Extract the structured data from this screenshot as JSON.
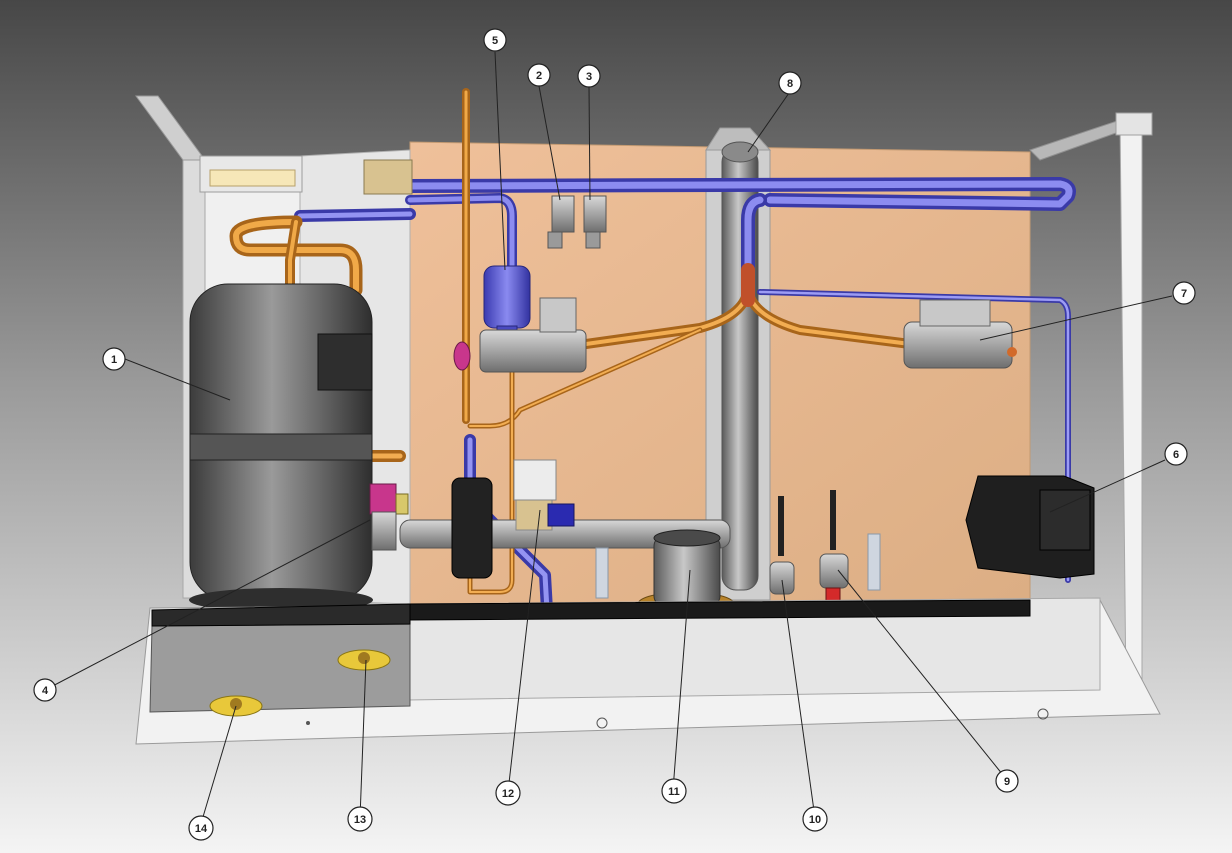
{
  "colors": {
    "background_top": "#4a4a4a",
    "background_bottom": "#f2f2f2",
    "back_panel": "#e8b890",
    "suction_pipe": "#6e6ee8",
    "discharge_pipe": "#d9882a",
    "compressor": "#6a6a6a",
    "frame": "#f4f4f4",
    "base_tray": "#ececec"
  },
  "callouts": [
    {
      "label": "1"
    },
    {
      "label": "2"
    },
    {
      "label": "3"
    },
    {
      "label": "4"
    },
    {
      "label": "5"
    },
    {
      "label": "6"
    },
    {
      "label": "7"
    },
    {
      "label": "8"
    },
    {
      "label": "9"
    },
    {
      "label": "10"
    },
    {
      "label": "11"
    },
    {
      "label": "12"
    },
    {
      "label": "13"
    },
    {
      "label": "14"
    }
  ]
}
